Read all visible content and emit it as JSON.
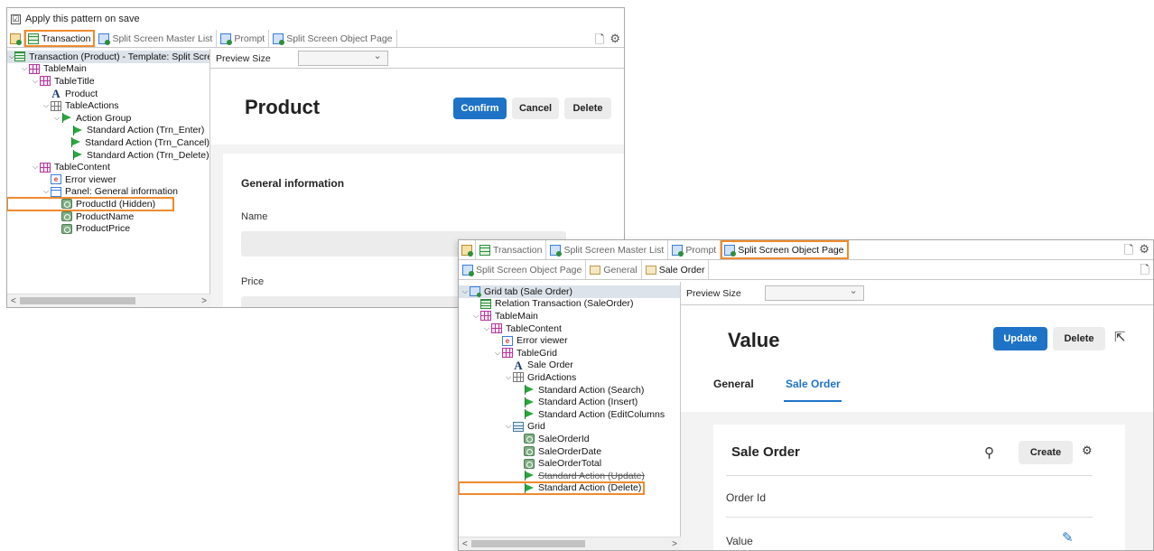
{
  "panel1": {
    "apply_pattern_label": "Apply this pattern on save",
    "checkbox_mark": "☑",
    "tabs": [
      {
        "label": "Transaction",
        "icon": "grid",
        "active": true,
        "highlighted": true
      },
      {
        "label": "Split Screen Master List",
        "icon": "object"
      },
      {
        "label": "Prompt",
        "icon": "object"
      },
      {
        "label": "Split Screen Object Page",
        "icon": "object"
      }
    ],
    "tree": [
      {
        "label": "Transaction (Product) - Template: Split Scree",
        "icon": "root",
        "indent": 0,
        "chev": "⌵",
        "selected": true
      },
      {
        "label": "TableMain",
        "icon": "table",
        "indent": 1,
        "chev": "⌵"
      },
      {
        "label": "TableTitle",
        "icon": "table",
        "indent": 2,
        "chev": "⌵"
      },
      {
        "label": "Product",
        "icon": "textA",
        "indent": 3
      },
      {
        "label": "TableActions",
        "icon": "grayt",
        "indent": 3,
        "chev": "⌵"
      },
      {
        "label": "Action Group",
        "icon": "flag",
        "indent": 4,
        "chev": "⌵"
      },
      {
        "label": "Standard Action (Trn_Enter)",
        "icon": "flag",
        "indent": 5
      },
      {
        "label": "Standard Action (Trn_Cancel)",
        "icon": "flag",
        "indent": 5
      },
      {
        "label": "Standard Action (Trn_Delete)",
        "icon": "flag",
        "indent": 5
      },
      {
        "label": "TableContent",
        "icon": "table",
        "indent": 2,
        "chev": "⌵"
      },
      {
        "label": "Error viewer",
        "icon": "errv",
        "indent": 3
      },
      {
        "label": "Panel: General information",
        "icon": "panel",
        "indent": 3,
        "chev": "⌵"
      },
      {
        "label": "ProductId (Hidden)",
        "icon": "attr",
        "indent": 4,
        "boxed": true
      },
      {
        "label": "ProductName",
        "icon": "attr",
        "indent": 4
      },
      {
        "label": "ProductPrice",
        "icon": "attr",
        "indent": 4
      }
    ],
    "scroll_left": "<",
    "scroll_right": ">",
    "preview_size_label": "Preview Size",
    "preview": {
      "title": "Product",
      "confirm": "Confirm",
      "cancel": "Cancel",
      "delete": "Delete",
      "section": "General information",
      "field_name": "Name",
      "field_price": "Price"
    }
  },
  "panel2": {
    "tabs": [
      {
        "label": "Transaction",
        "icon": "grid"
      },
      {
        "label": "Split Screen Master List",
        "icon": "object"
      },
      {
        "label": "Prompt",
        "icon": "object"
      },
      {
        "label": "Split Screen Object Page",
        "icon": "object",
        "active": true,
        "highlighted": true
      }
    ],
    "subtabs": [
      {
        "label": "Split Screen Object Page",
        "icon": "object"
      },
      {
        "label": "General",
        "icon": "folder"
      },
      {
        "label": "Sale Order",
        "icon": "folder",
        "active": true
      }
    ],
    "tree": [
      {
        "label": "Grid tab (Sale Order)",
        "icon": "gridtab",
        "indent": 0,
        "chev": "⌵",
        "selected": true
      },
      {
        "label": "Relation Transaction (SaleOrder)",
        "icon": "relt",
        "indent": 1
      },
      {
        "label": "TableMain",
        "icon": "table",
        "indent": 1,
        "chev": "⌵"
      },
      {
        "label": "TableContent",
        "icon": "table",
        "indent": 2,
        "chev": "⌵"
      },
      {
        "label": "Error viewer",
        "icon": "errv",
        "indent": 3
      },
      {
        "label": "TableGrid",
        "icon": "table",
        "indent": 3,
        "chev": "⌵"
      },
      {
        "label": "Sale Order",
        "icon": "textA",
        "indent": 4
      },
      {
        "label": "GridActions",
        "icon": "grayt",
        "indent": 4,
        "chev": "⌵"
      },
      {
        "label": "Standard Action (Search)",
        "icon": "flag",
        "indent": 5
      },
      {
        "label": "Standard Action (Insert)",
        "icon": "flag",
        "indent": 5
      },
      {
        "label": "Standard Action (EditColumns",
        "icon": "flag",
        "indent": 5
      },
      {
        "label": "Grid",
        "icon": "gridic",
        "indent": 4,
        "chev": "⌵"
      },
      {
        "label": "SaleOrderId",
        "icon": "attr",
        "indent": 5
      },
      {
        "label": "SaleOrderDate",
        "icon": "attr",
        "indent": 5
      },
      {
        "label": "SaleOrderTotal",
        "icon": "attr",
        "indent": 5
      },
      {
        "label": "Standard Action (Update)",
        "icon": "flag",
        "indent": 5,
        "strike": true
      },
      {
        "label": "Standard Action (Delete)",
        "icon": "flag",
        "indent": 5,
        "boxed": true
      }
    ],
    "scroll_left": "<",
    "scroll_right": ">",
    "preview_size_label": "Preview Size",
    "preview": {
      "title": "Value",
      "update": "Update",
      "delete": "Delete",
      "tab_general": "General",
      "tab_sale_order": "Sale Order",
      "grid_title": "Sale Order",
      "create": "Create",
      "row_header": "Order Id",
      "row_value": "Value"
    }
  }
}
